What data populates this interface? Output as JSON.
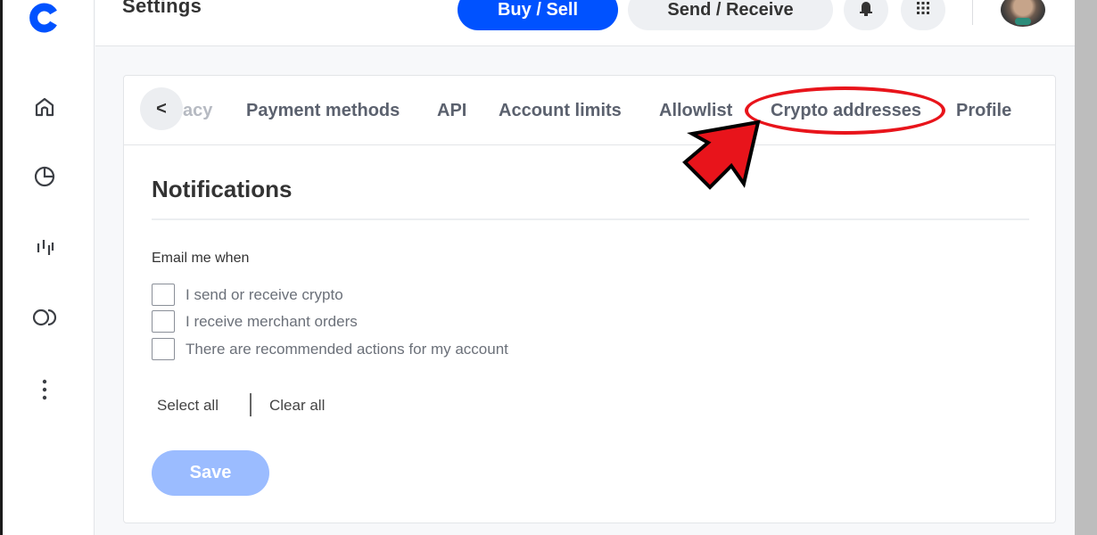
{
  "header": {
    "title": "Settings",
    "buy_sell_label": "Buy / Sell",
    "send_receive_label": "Send / Receive"
  },
  "sidebar": {
    "items": [
      {
        "name": "home",
        "icon": "home-icon"
      },
      {
        "name": "portfolio",
        "icon": "pie-chart-icon"
      },
      {
        "name": "trade",
        "icon": "candlestick-icon"
      },
      {
        "name": "earn",
        "icon": "coins-icon"
      },
      {
        "name": "more",
        "icon": "more-vertical-icon"
      }
    ]
  },
  "tabs": {
    "back_label": "<",
    "items": [
      {
        "label": "acy",
        "faded": true
      },
      {
        "label": "Payment methods"
      },
      {
        "label": "API"
      },
      {
        "label": "Account limits"
      },
      {
        "label": "Allowlist"
      },
      {
        "label": "Crypto addresses",
        "highlighted": true
      },
      {
        "label": "Profile"
      }
    ]
  },
  "notifications": {
    "title": "Notifications",
    "group_label": "Email me when",
    "options": [
      {
        "label": "I send or receive crypto",
        "checked": false
      },
      {
        "label": "I receive merchant orders",
        "checked": false
      },
      {
        "label": "There are recommended actions for my account",
        "checked": false
      }
    ],
    "select_all_label": "Select all",
    "clear_all_label": "Clear all",
    "save_label": "Save"
  },
  "colors": {
    "brand_blue": "#0052ff",
    "save_disabled": "#9bbcff",
    "annotation_red": "#e8141b"
  }
}
